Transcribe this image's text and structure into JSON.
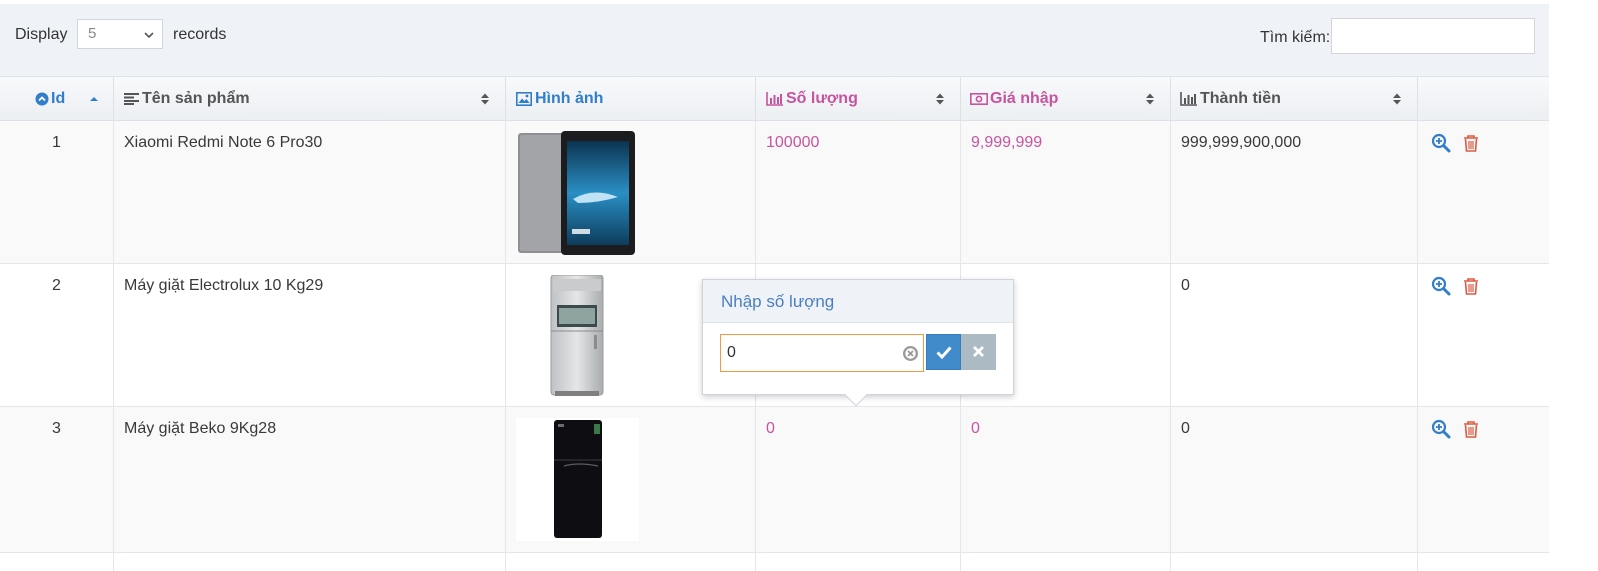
{
  "toolbar": {
    "display_label": "Display",
    "display_value": "5",
    "records_label": "records",
    "search_label": "Tìm kiếm:",
    "search_value": ""
  },
  "columns": [
    {
      "label": "Id",
      "icon": "circle-chevron-up-icon"
    },
    {
      "label": "Tên sản phẩm",
      "icon": "align-left-icon"
    },
    {
      "label": "Hình ảnh",
      "icon": "image-icon"
    },
    {
      "label": "Số lượng",
      "icon": "bar-chart-icon"
    },
    {
      "label": "Giá nhập",
      "icon": "money-icon"
    },
    {
      "label": "Thành tiền",
      "icon": "bar-chart-icon"
    }
  ],
  "rows": [
    {
      "id": "1",
      "name": "Xiaomi Redmi Note 6 Pro30",
      "image": "tablet-image",
      "qty": "100000",
      "price": "9,999,999",
      "total": "999,999,900,000"
    },
    {
      "id": "2",
      "name": "Máy giặt Electrolux 10 Kg29",
      "image": "silver-fridge-image",
      "qty": "",
      "price": "",
      "total": "0"
    },
    {
      "id": "3",
      "name": "Máy giặt Beko 9Kg28",
      "image": "black-fridge-image",
      "qty": "0",
      "price": "0",
      "total": "0"
    }
  ],
  "popover": {
    "title": "Nhập số lượng",
    "input_value": "0"
  },
  "colors": {
    "blue": "#307ecc",
    "pink": "#c6549f",
    "danger": "#dd5a43"
  }
}
